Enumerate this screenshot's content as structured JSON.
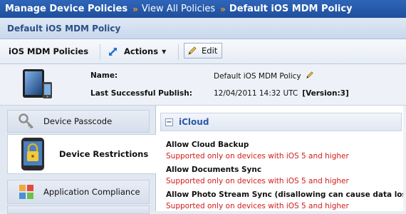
{
  "breadcrumb": {
    "items": [
      "Manage Device Policies",
      "View All Policies",
      "Default iOS MDM Policy"
    ],
    "separator": "»"
  },
  "page": {
    "title": "Default iOS MDM Policy"
  },
  "toolbar": {
    "policies_label": "iOS MDM Policies",
    "actions_label": "Actions",
    "edit_label": "Edit"
  },
  "info": {
    "name_label": "Name:",
    "name_value": "Default iOS MDM Policy",
    "publish_label": "Last Successful Publish:",
    "publish_value": "12/04/2011 14:32 UTC",
    "version": "[Version:3]"
  },
  "sidebar": {
    "items": [
      {
        "label": "Device Passcode",
        "icon": "key-icon"
      },
      {
        "label": "Device Restrictions",
        "icon": "lock-icon",
        "active": true
      },
      {
        "label": "Application Compliance",
        "icon": "apps-icon"
      }
    ]
  },
  "main": {
    "section_title": "iCloud",
    "settings": [
      {
        "name": "Allow Cloud Backup",
        "note": "Supported only on devices with iOS 5 and higher"
      },
      {
        "name": "Allow Documents Sync",
        "note": "Supported only on devices with iOS 5 and higher"
      },
      {
        "name": "Allow Photo Stream Sync (disallowing can cause data loss)",
        "note": "Supported only on devices with iOS 5 and higher"
      }
    ]
  },
  "colors": {
    "breadcrumb_bg": "#2f65b9",
    "separator": "#f4a11e",
    "section_title": "#2a5aa8",
    "note_red": "#d31b1b"
  }
}
